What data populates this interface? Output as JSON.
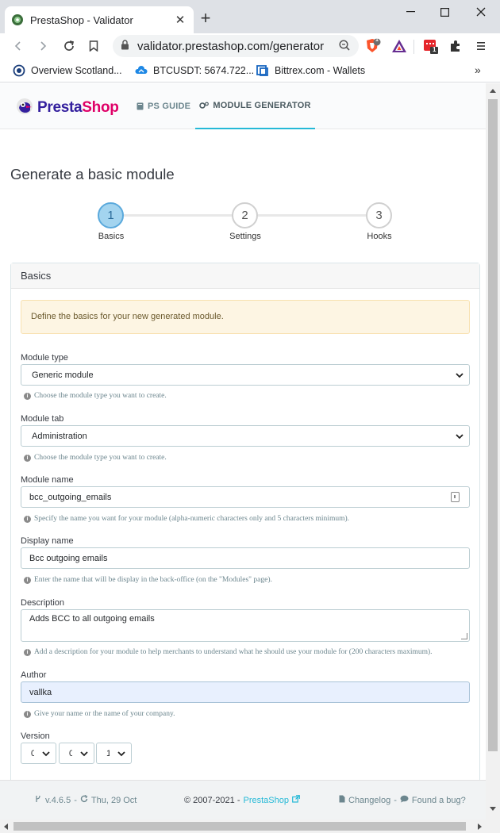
{
  "browser": {
    "tab_title": "PrestaShop - Validator",
    "url": "validator.prestashop.com/generator",
    "shield_badge": "1",
    "ext_badge": "1",
    "bookmarks": [
      {
        "label": "Overview Scotland..."
      },
      {
        "label": "BTCUSDT: 5674.722..."
      },
      {
        "label": "Bittrex.com - Wallets"
      }
    ]
  },
  "site": {
    "logo_part1": "Presta",
    "logo_part2": "Shop",
    "nav": [
      {
        "label": "PS GUIDE"
      },
      {
        "label": "MODULE GENERATOR"
      }
    ]
  },
  "page": {
    "title": "Generate a basic module",
    "steps": [
      {
        "number": "1",
        "label": "Basics"
      },
      {
        "number": "2",
        "label": "Settings"
      },
      {
        "number": "3",
        "label": "Hooks"
      }
    ]
  },
  "panel": {
    "heading": "Basics",
    "alert": "Define the basics for your new generated module.",
    "module_type": {
      "label": "Module type",
      "value": "Generic module",
      "hint": "Choose the module type you want to create."
    },
    "module_tab": {
      "label": "Module tab",
      "value": "Administration",
      "hint": "Choose the module type you want to create."
    },
    "module_name": {
      "label": "Module name",
      "value": "bcc_outgoing_emails",
      "hint": "Specify the name you want for your module (alpha-numeric characters only and 5 characters minimum)."
    },
    "display_name": {
      "label": "Display name",
      "value": "Bcc outgoing emails",
      "hint": "Enter the name that will be display in the back-office (on the \"Modules\" page)."
    },
    "description": {
      "label": "Description",
      "value": "Adds BCC to all outgoing emails",
      "hint": "Add a description for your module to help merchants to understand what he should use your module for (200 characters maximum)."
    },
    "author": {
      "label": "Author",
      "value": "vallka",
      "hint": "Give your name or the name of your company."
    },
    "version": {
      "label": "Version",
      "values": [
        "0",
        "0",
        "1"
      ]
    }
  },
  "footer": {
    "version": "v.4.6.5",
    "date": "Thu, 29 Oct",
    "copyright": "© 2007-2021 -",
    "brand_link": "PrestaShop",
    "changelog": "Changelog",
    "bug_separator": "-",
    "bug": "Found a bug?"
  }
}
